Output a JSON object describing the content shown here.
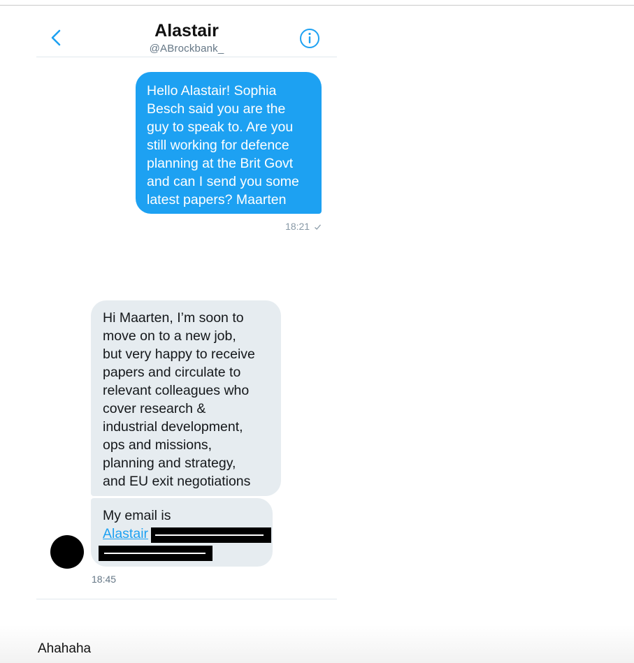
{
  "header": {
    "name": "Alastair",
    "handle": "@ABrockbank_",
    "back_icon": "chevron-left-icon",
    "info_icon": "info-icon",
    "accent_color": "#1da1f2"
  },
  "messages": [
    {
      "direction": "outgoing",
      "lines": [
        "Hello Alastair! Sophia",
        "Besch said you are the",
        "guy to speak to. Are you",
        "still working for defence",
        "planning at the Brit Govt",
        "and can I send you some",
        "latest papers? Maarten"
      ],
      "time": "18:21",
      "status_icon": "checkmark-icon"
    },
    {
      "direction": "incoming",
      "lines": [
        "Hi Maarten, I’m soon to",
        "move on to a new job,",
        "but very happy to receive",
        "papers and circulate to",
        "relevant colleagues who",
        "cover research &",
        "industrial development,",
        "ops and missions,",
        "planning and strategy,",
        "and EU exit negotiations"
      ]
    },
    {
      "direction": "incoming",
      "text": "My email is",
      "link_text": "Alastair",
      "time": "18:45"
    }
  ],
  "composer": {
    "text": "Ahahaha"
  }
}
